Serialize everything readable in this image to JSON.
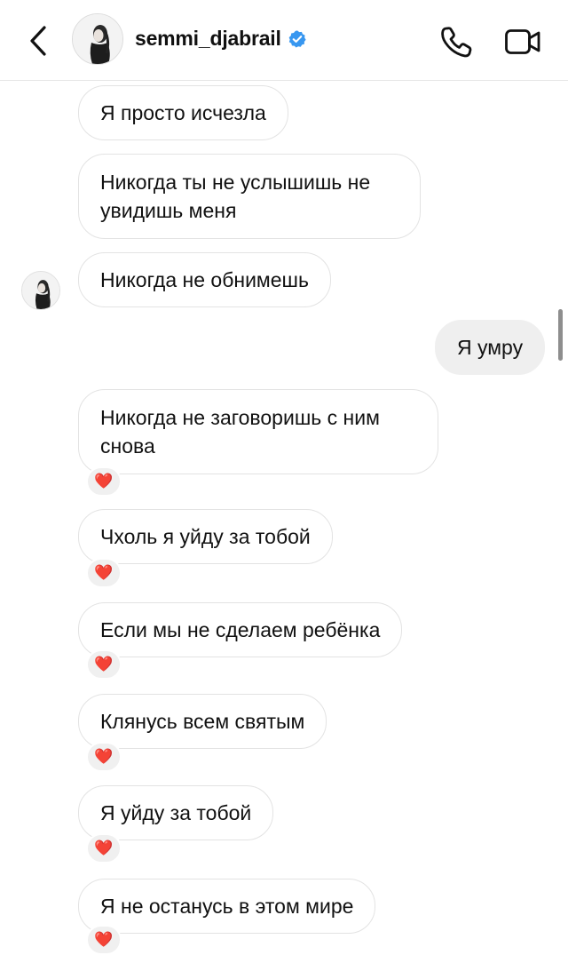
{
  "header": {
    "username": "semmi_djabrail",
    "verified": true,
    "back_icon": "chevron-left-icon",
    "call_icon": "phone-icon",
    "video_icon": "video-camera-icon"
  },
  "messages": [
    {
      "sender": "them",
      "text": "Я просто исчезла"
    },
    {
      "sender": "them",
      "text": "Никогда ты не услышишь не увидишь меня"
    },
    {
      "sender": "them",
      "text": "Никогда не обнимешь"
    },
    {
      "sender": "me",
      "text": "Я умру"
    },
    {
      "sender": "them",
      "text": "Никогда не заговоришь с ним снова",
      "reaction": "❤️"
    },
    {
      "sender": "them",
      "text": "Чхоль я уйду за тобой",
      "reaction": "❤️"
    },
    {
      "sender": "them",
      "text": "Если мы не сделаем ребёнка",
      "reaction": "❤️"
    },
    {
      "sender": "them",
      "text": "Клянусь всем святым",
      "reaction": "❤️"
    },
    {
      "sender": "them",
      "text": "Я уйду за тобой",
      "reaction": "❤️"
    },
    {
      "sender": "them",
      "text": "Я не останусь в этом мире",
      "reaction": "❤️"
    }
  ],
  "colors": {
    "verified_blue": "#3897f0",
    "heart_red": "#e0142b",
    "my_bubble": "#efefef"
  }
}
